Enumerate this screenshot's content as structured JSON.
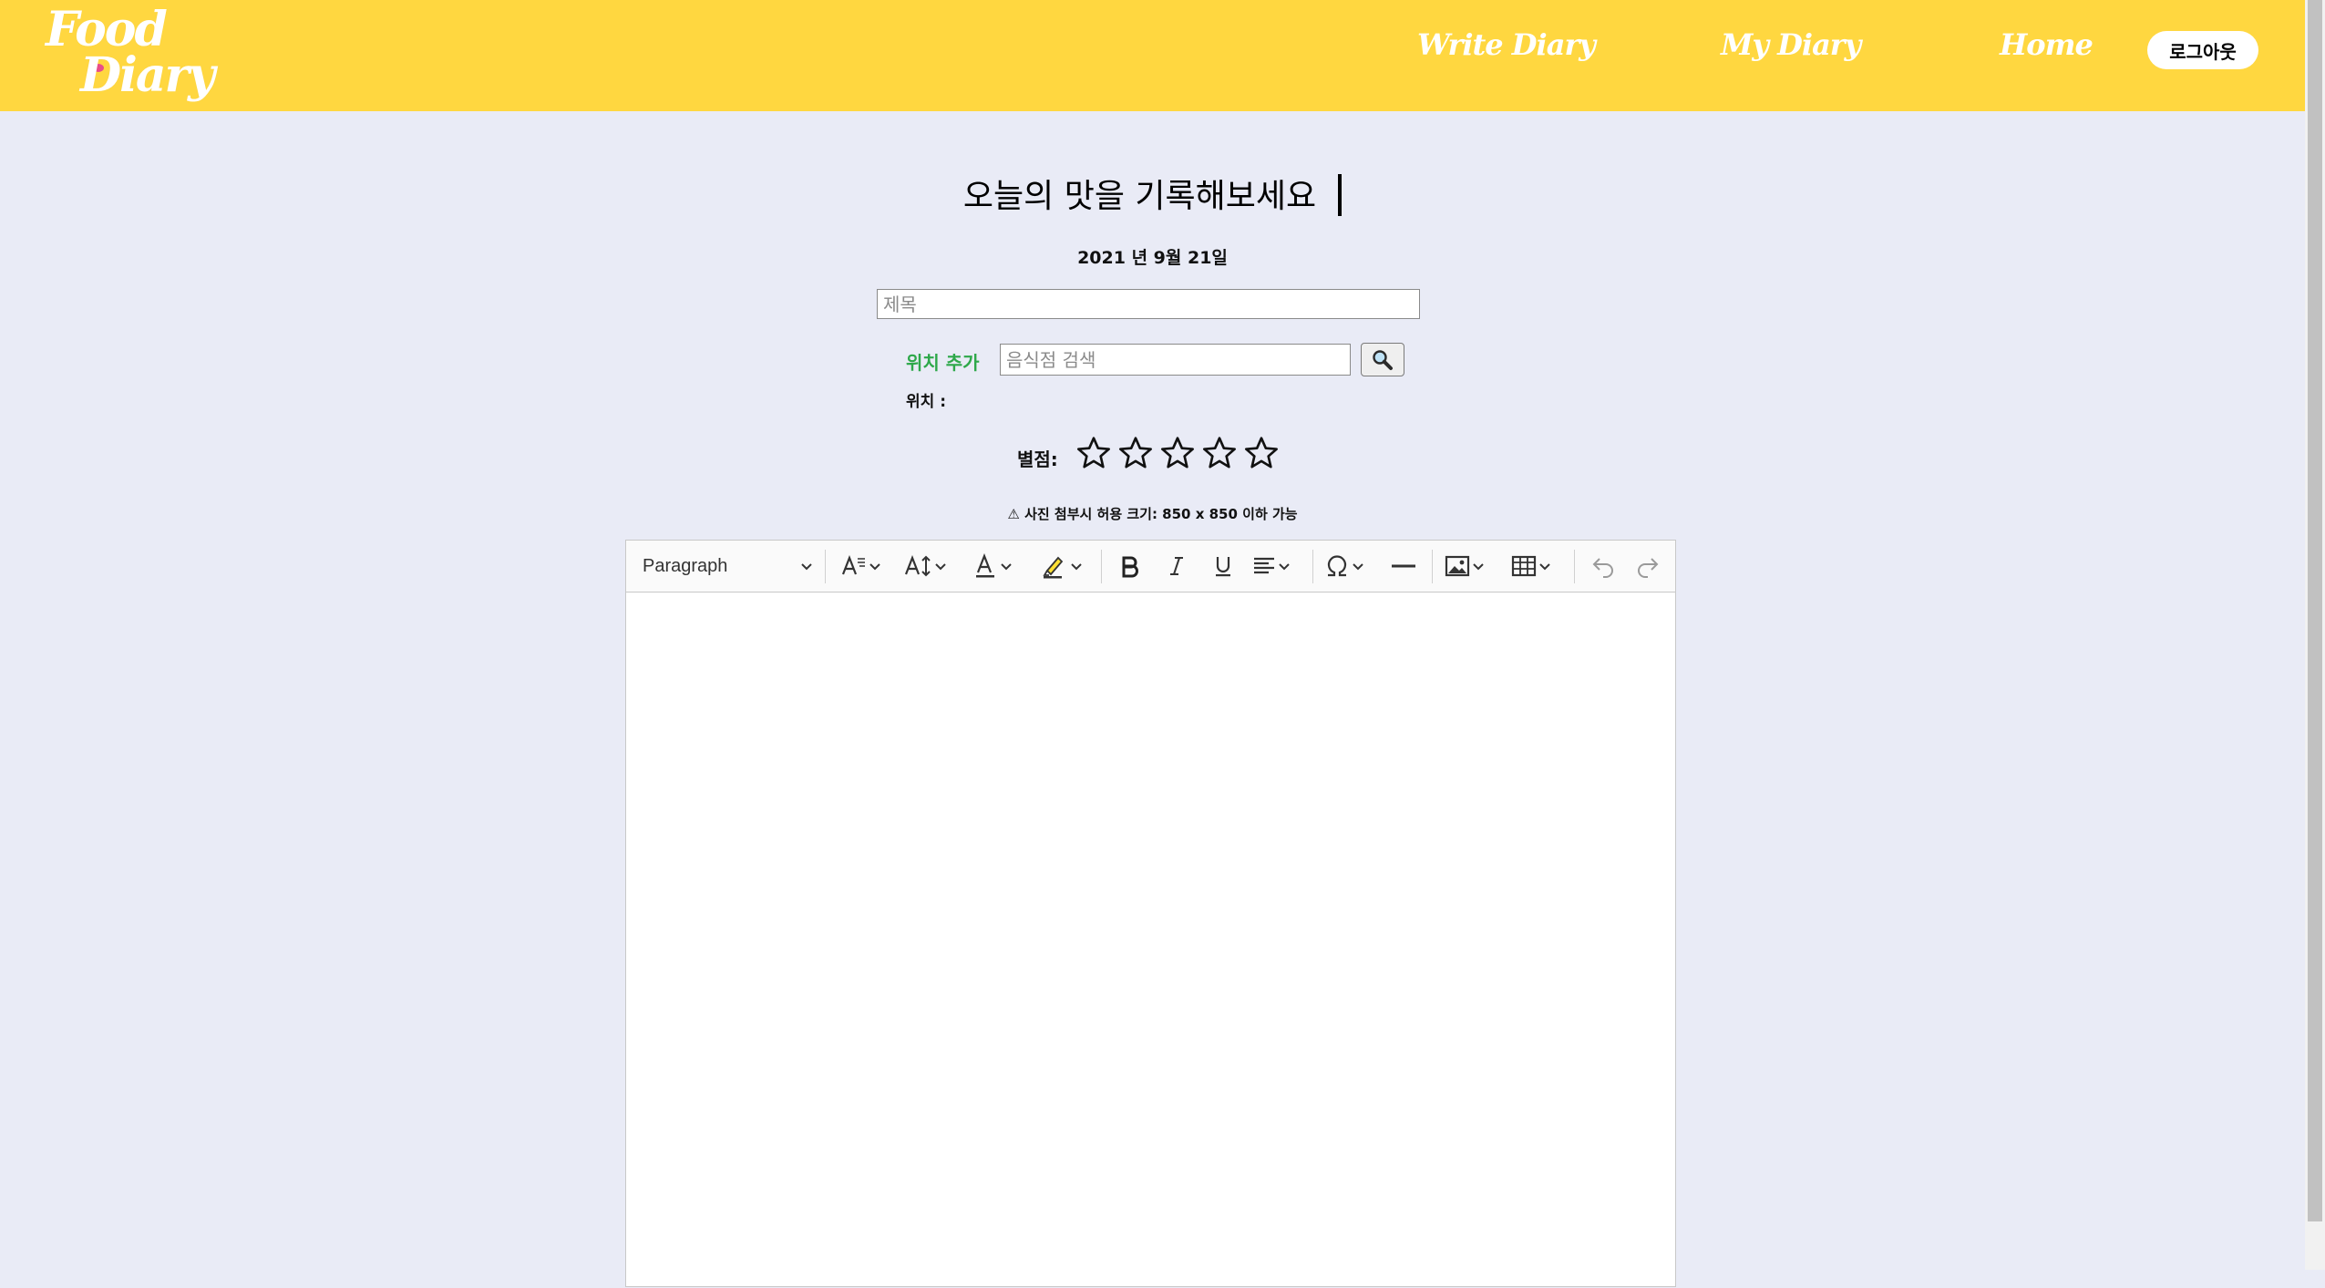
{
  "brand": {
    "line1": "Food",
    "line2": "Diary"
  },
  "nav": {
    "write": "Write Diary",
    "my": "My Diary",
    "home": "Home",
    "logout": "로그아웃"
  },
  "heading": "오늘의 맛을 기록해보세요",
  "date": "2021 년 9월 21일",
  "title_field": {
    "placeholder": "제목",
    "value": ""
  },
  "location": {
    "add_label": "위치 추가",
    "search_placeholder": "음식점 검색",
    "result_label": "위치 :",
    "result_value": ""
  },
  "rating": {
    "label": "별점:",
    "max": 5,
    "value": 0
  },
  "warning": "⚠ 사진 첨부시 허용 크기: 850 x 850 이하 가능",
  "editor": {
    "paragraph": "Paragraph",
    "toolbar_icons": [
      "font-family-icon",
      "font-size-icon",
      "font-color-icon",
      "highlight-icon",
      "bold-icon",
      "italic-icon",
      "underline-icon",
      "align-icon",
      "special-characters-icon",
      "horizontal-line-icon",
      "insert-image-icon",
      "insert-table-icon",
      "undo-icon",
      "redo-icon"
    ],
    "content": ""
  },
  "colors": {
    "navbar": "#ffd740",
    "background": "#e9ebf6",
    "location_link": "#2ea84a"
  }
}
